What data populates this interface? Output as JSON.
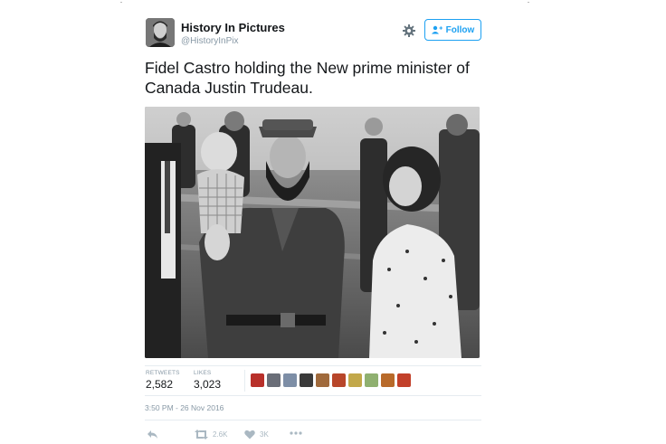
{
  "user": {
    "name": "History In Pictures",
    "handle": "@HistoryInPix"
  },
  "follow_label": "Follow",
  "tweet_text": "Fidel Castro holding the New prime minister of Canada Justin Trudeau.",
  "stats": {
    "retweets_label": "RETWEETS",
    "retweets_value": "2,582",
    "likes_label": "LIKES",
    "likes_value": "3,023"
  },
  "timestamp": "3:50 PM - 26 Nov 2016",
  "actions": {
    "retweet_count": "2.6K",
    "like_count": "3K"
  },
  "icons": [
    "gear-icon",
    "follow-person-icon",
    "reply-icon",
    "retweet-icon",
    "heart-icon",
    "more-icon"
  ],
  "colors": {
    "accent": "#1da1f2",
    "secondary_text": "#8899a6",
    "border": "#e6ecf0"
  },
  "liker_avatar_colors": [
    "#b8302a",
    "#6a6e78",
    "#7d8ea6",
    "#3a3a3a",
    "#a06a3c",
    "#b8462a",
    "#c2a84a",
    "#8fb070",
    "#b86a2a",
    "#c2402a"
  ]
}
